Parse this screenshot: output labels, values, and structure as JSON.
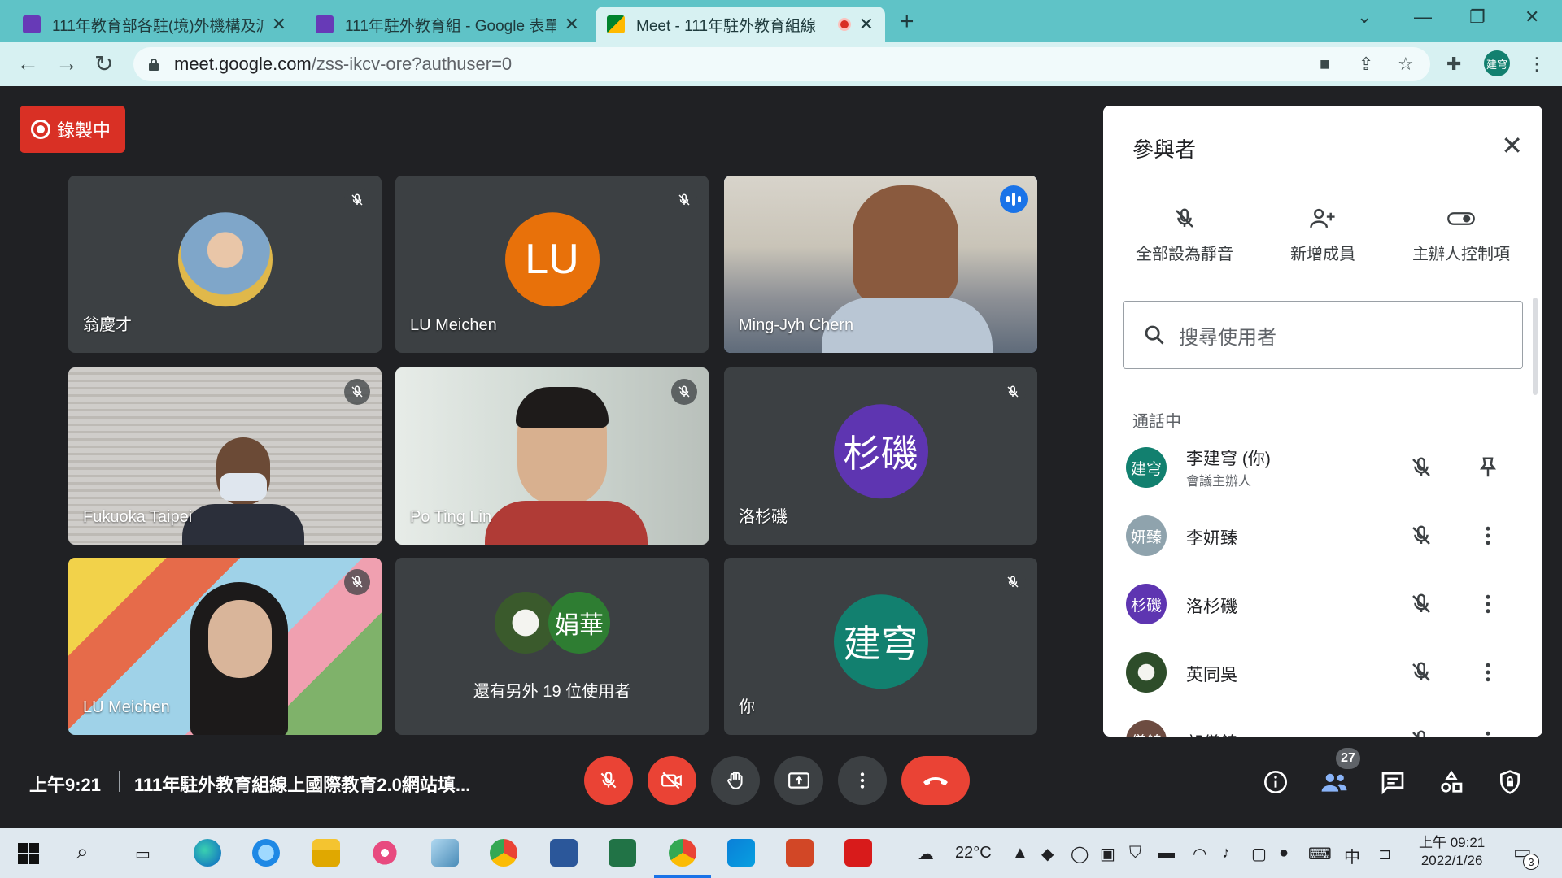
{
  "browser": {
    "tabs": [
      {
        "title": "111年教育部各駐(境)外機構及派",
        "favicon_color": "#673ab7"
      },
      {
        "title": "111年駐外教育組 - Google 表單",
        "favicon_color": "#673ab7"
      },
      {
        "title": "Meet - 111年駐外教育組線",
        "favicon_color": "#00832d",
        "active": true
      }
    ],
    "url_host": "meet.google.com",
    "url_path": "/zss-ikcv-ore?authuser=0",
    "profile_initials": "建穹"
  },
  "meet": {
    "recording_label": "錄製中",
    "tiles": [
      {
        "name": "翁慶才",
        "type": "photo-avatar",
        "muted": true
      },
      {
        "name": "LU Meichen",
        "type": "initials",
        "initials": "LU",
        "color": "#e8710a",
        "muted": true
      },
      {
        "name": "Ming-Jyh Chern",
        "type": "video",
        "speaking": true
      },
      {
        "name": "Fukuoka Taipei",
        "type": "video",
        "muted": true
      },
      {
        "name": "Po Ting Lin",
        "type": "video",
        "muted": true
      },
      {
        "name": "洛杉磯",
        "type": "initials",
        "initials": "杉磯",
        "color": "#5e35b1",
        "muted": true
      },
      {
        "name": "LU Meichen",
        "type": "video",
        "muted": true
      },
      {
        "name": "還有另外 19 位使用者",
        "type": "others",
        "initials": "娟華"
      },
      {
        "name": "你",
        "type": "initials",
        "initials": "建穹",
        "color": "#12806f",
        "muted": true
      }
    ],
    "clock": "上午9:21",
    "meeting_title": "111年駐外教育組線上國際教育2.0網站填...",
    "participant_count": "27"
  },
  "panel": {
    "title": "參與者",
    "actions": [
      "全部設為靜音",
      "新增成員",
      "主辦人控制項"
    ],
    "search_placeholder": "搜尋使用者",
    "section_label": "通話中",
    "participants": [
      {
        "initials": "建穹",
        "name": "李建穹 (你)",
        "sub": "會議主辦人",
        "color": "#12806f"
      },
      {
        "initials": "妍臻",
        "name": "李妍臻",
        "color": "#8fa3ad"
      },
      {
        "initials": "杉磯",
        "name": "洛杉磯",
        "color": "#5e35b1"
      },
      {
        "initials": "",
        "name": "英同吳",
        "color": "#2e4d2a"
      },
      {
        "initials": "儀錦",
        "name": "郎儀錦",
        "color": "#6d4c41"
      }
    ]
  },
  "taskbar": {
    "weather": "22°C",
    "ime": "中",
    "time": "上午 09:21",
    "date": "2022/1/26",
    "notifications": "3"
  }
}
